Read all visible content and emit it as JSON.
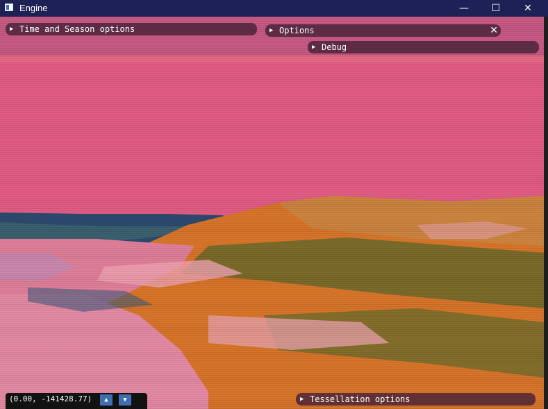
{
  "window": {
    "title": "Engine",
    "minimize_glyph": "—",
    "maximize_glyph": "☐",
    "close_glyph": "✕"
  },
  "panels": {
    "time_season": {
      "label": "Time and Season options"
    },
    "options": {
      "label": "Options",
      "close_glyph": "✕"
    },
    "debug": {
      "label": "Debug"
    },
    "tessellation": {
      "label": "Tessellation options"
    }
  },
  "coordinates": {
    "text": "(0.00, -141428.77)",
    "up_glyph": "▲",
    "down_glyph": "▼"
  },
  "expand_glyph": "▶",
  "colors": {
    "titlebar": "#1e2155",
    "sky": "#e85f86",
    "sea": "#2c4a6e",
    "land_orange": "#d8752a",
    "land_green": "#6b6a2a",
    "beach_pink": "#e07f9a"
  }
}
